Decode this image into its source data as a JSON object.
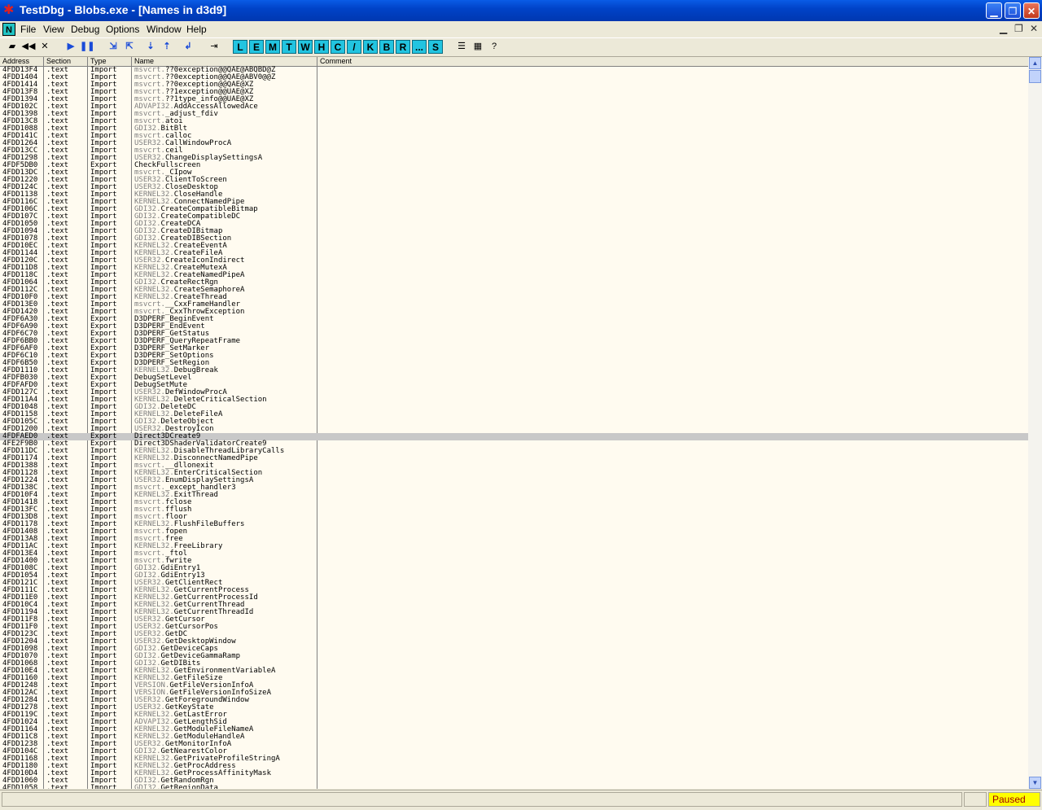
{
  "window": {
    "title": "TestDbg - Blobs.exe - [Names in d3d9]"
  },
  "menu": {
    "logo": "N",
    "items": [
      "File",
      "View",
      "Debug",
      "Options",
      "Window",
      "Help"
    ]
  },
  "toolbar": {
    "letter_buttons": [
      "L",
      "E",
      "M",
      "T",
      "W",
      "H",
      "C",
      "/",
      "K",
      "B",
      "R",
      "...",
      "S"
    ]
  },
  "table": {
    "columns": [
      "Address",
      "Section",
      "Type",
      "Name",
      "Comment"
    ],
    "selected_index": 50,
    "rows": [
      [
        "4FDD13F4",
        ".text",
        "Import",
        "msvcrt.",
        "??0exception@@QAE@ABQBD@Z"
      ],
      [
        "4FDD1404",
        ".text",
        "Import",
        "msvcrt.",
        "??0exception@@QAE@ABV0@@Z"
      ],
      [
        "4FDD1414",
        ".text",
        "Import",
        "msvcrt.",
        "??0exception@@QAE@XZ"
      ],
      [
        "4FDD13F8",
        ".text",
        "Import",
        "msvcrt.",
        "??1exception@@UAE@XZ"
      ],
      [
        "4FDD1394",
        ".text",
        "Import",
        "msvcrt.",
        "??1type_info@@UAE@XZ"
      ],
      [
        "4FDD102C",
        ".text",
        "Import",
        "ADVAPI32.",
        "AddAccessAllowedAce"
      ],
      [
        "4FDD1398",
        ".text",
        "Import",
        "msvcrt.",
        "_adjust_fdiv"
      ],
      [
        "4FDD13C8",
        ".text",
        "Import",
        "msvcrt.",
        "atoi"
      ],
      [
        "4FDD1088",
        ".text",
        "Import",
        "GDI32.",
        "BitBlt"
      ],
      [
        "4FDD141C",
        ".text",
        "Import",
        "msvcrt.",
        "calloc"
      ],
      [
        "4FDD1264",
        ".text",
        "Import",
        "USER32.",
        "CallWindowProcA"
      ],
      [
        "4FDD13CC",
        ".text",
        "Import",
        "msvcrt.",
        "ceil"
      ],
      [
        "4FDD1298",
        ".text",
        "Import",
        "USER32.",
        "ChangeDisplaySettingsA"
      ],
      [
        "4FDF5DB0",
        ".text",
        "Export",
        "",
        "CheckFullscreen"
      ],
      [
        "4FDD13DC",
        ".text",
        "Import",
        "msvcrt.",
        "_CIpow"
      ],
      [
        "4FDD1220",
        ".text",
        "Import",
        "USER32.",
        "ClientToScreen"
      ],
      [
        "4FDD124C",
        ".text",
        "Import",
        "USER32.",
        "CloseDesktop"
      ],
      [
        "4FDD1138",
        ".text",
        "Import",
        "KERNEL32.",
        "CloseHandle"
      ],
      [
        "4FDD116C",
        ".text",
        "Import",
        "KERNEL32.",
        "ConnectNamedPipe"
      ],
      [
        "4FDD106C",
        ".text",
        "Import",
        "GDI32.",
        "CreateCompatibleBitmap"
      ],
      [
        "4FDD107C",
        ".text",
        "Import",
        "GDI32.",
        "CreateCompatibleDC"
      ],
      [
        "4FDD1050",
        ".text",
        "Import",
        "GDI32.",
        "CreateDCA"
      ],
      [
        "4FDD1094",
        ".text",
        "Import",
        "GDI32.",
        "CreateDIBitmap"
      ],
      [
        "4FDD1078",
        ".text",
        "Import",
        "GDI32.",
        "CreateDIBSection"
      ],
      [
        "4FDD10EC",
        ".text",
        "Import",
        "KERNEL32.",
        "CreateEventA"
      ],
      [
        "4FDD1144",
        ".text",
        "Import",
        "KERNEL32.",
        "CreateFileA"
      ],
      [
        "4FDD120C",
        ".text",
        "Import",
        "USER32.",
        "CreateIconIndirect"
      ],
      [
        "4FDD11D8",
        ".text",
        "Import",
        "KERNEL32.",
        "CreateMutexA"
      ],
      [
        "4FDD118C",
        ".text",
        "Import",
        "KERNEL32.",
        "CreateNamedPipeA"
      ],
      [
        "4FDD1064",
        ".text",
        "Import",
        "GDI32.",
        "CreateRectRgn"
      ],
      [
        "4FDD112C",
        ".text",
        "Import",
        "KERNEL32.",
        "CreateSemaphoreA"
      ],
      [
        "4FDD10F0",
        ".text",
        "Import",
        "KERNEL32.",
        "CreateThread"
      ],
      [
        "4FDD13E0",
        ".text",
        "Import",
        "msvcrt.",
        "__CxxFrameHandler"
      ],
      [
        "4FDD1420",
        ".text",
        "Import",
        "msvcrt.",
        "_CxxThrowException"
      ],
      [
        "4FDF6A30",
        ".text",
        "Export",
        "",
        "D3DPERF_BeginEvent"
      ],
      [
        "4FDF6A90",
        ".text",
        "Export",
        "",
        "D3DPERF_EndEvent"
      ],
      [
        "4FDF6C70",
        ".text",
        "Export",
        "",
        "D3DPERF_GetStatus"
      ],
      [
        "4FDF6BB0",
        ".text",
        "Export",
        "",
        "D3DPERF_QueryRepeatFrame"
      ],
      [
        "4FDF6AF0",
        ".text",
        "Export",
        "",
        "D3DPERF_SetMarker"
      ],
      [
        "4FDF6C10",
        ".text",
        "Export",
        "",
        "D3DPERF_SetOptions"
      ],
      [
        "4FDF6B50",
        ".text",
        "Export",
        "",
        "D3DPERF_SetRegion"
      ],
      [
        "4FDD1110",
        ".text",
        "Import",
        "KERNEL32.",
        "DebugBreak"
      ],
      [
        "4FDFB030",
        ".text",
        "Export",
        "",
        "DebugSetLevel"
      ],
      [
        "4FDFAFD0",
        ".text",
        "Export",
        "",
        "DebugSetMute"
      ],
      [
        "4FDD127C",
        ".text",
        "Import",
        "USER32.",
        "DefWindowProcA"
      ],
      [
        "4FDD11A4",
        ".text",
        "Import",
        "KERNEL32.",
        "DeleteCriticalSection"
      ],
      [
        "4FDD1048",
        ".text",
        "Import",
        "GDI32.",
        "DeleteDC"
      ],
      [
        "4FDD1158",
        ".text",
        "Import",
        "KERNEL32.",
        "DeleteFileA"
      ],
      [
        "4FDD105C",
        ".text",
        "Import",
        "GDI32.",
        "DeleteObject"
      ],
      [
        "4FDD1200",
        ".text",
        "Import",
        "USER32.",
        "DestroyIcon"
      ],
      [
        "4FDFAED0",
        ".text",
        "Export",
        "",
        "Direct3DCreate9"
      ],
      [
        "4FE2F9B0",
        ".text",
        "Export",
        "",
        "Direct3DShaderValidatorCreate9"
      ],
      [
        "4FDD11DC",
        ".text",
        "Import",
        "KERNEL32.",
        "DisableThreadLibraryCalls"
      ],
      [
        "4FDD1174",
        ".text",
        "Import",
        "KERNEL32.",
        "DisconnectNamedPipe"
      ],
      [
        "4FDD1388",
        ".text",
        "Import",
        "msvcrt.",
        "__dllonexit"
      ],
      [
        "4FDD1128",
        ".text",
        "Import",
        "KERNEL32.",
        "EnterCriticalSection"
      ],
      [
        "4FDD1224",
        ".text",
        "Import",
        "USER32.",
        "EnumDisplaySettingsA"
      ],
      [
        "4FDD138C",
        ".text",
        "Import",
        "msvcrt.",
        "_except_handler3"
      ],
      [
        "4FDD10F4",
        ".text",
        "Import",
        "KERNEL32.",
        "ExitThread"
      ],
      [
        "4FDD1418",
        ".text",
        "Import",
        "msvcrt.",
        "fclose"
      ],
      [
        "4FDD13FC",
        ".text",
        "Import",
        "msvcrt.",
        "fflush"
      ],
      [
        "4FDD13D8",
        ".text",
        "Import",
        "msvcrt.",
        "floor"
      ],
      [
        "4FDD1178",
        ".text",
        "Import",
        "KERNEL32.",
        "FlushFileBuffers"
      ],
      [
        "4FDD1408",
        ".text",
        "Import",
        "msvcrt.",
        "fopen"
      ],
      [
        "4FDD13A8",
        ".text",
        "Import",
        "msvcrt.",
        "free"
      ],
      [
        "4FDD11AC",
        ".text",
        "Import",
        "KERNEL32.",
        "FreeLibrary"
      ],
      [
        "4FDD13E4",
        ".text",
        "Import",
        "msvcrt.",
        "_ftol"
      ],
      [
        "4FDD1400",
        ".text",
        "Import",
        "msvcrt.",
        "fwrite"
      ],
      [
        "4FDD108C",
        ".text",
        "Import",
        "GDI32.",
        "GdiEntry1"
      ],
      [
        "4FDD1054",
        ".text",
        "Import",
        "GDI32.",
        "GdiEntry13"
      ],
      [
        "4FDD121C",
        ".text",
        "Import",
        "USER32.",
        "GetClientRect"
      ],
      [
        "4FDD111C",
        ".text",
        "Import",
        "KERNEL32.",
        "GetCurrentProcess"
      ],
      [
        "4FDD11E0",
        ".text",
        "Import",
        "KERNEL32.",
        "GetCurrentProcessId"
      ],
      [
        "4FDD10C4",
        ".text",
        "Import",
        "KERNEL32.",
        "GetCurrentThread"
      ],
      [
        "4FDD1194",
        ".text",
        "Import",
        "KERNEL32.",
        "GetCurrentThreadId"
      ],
      [
        "4FDD11F8",
        ".text",
        "Import",
        "USER32.",
        "GetCursor"
      ],
      [
        "4FDD11F0",
        ".text",
        "Import",
        "USER32.",
        "GetCursorPos"
      ],
      [
        "4FDD123C",
        ".text",
        "Import",
        "USER32.",
        "GetDC"
      ],
      [
        "4FDD1204",
        ".text",
        "Import",
        "USER32.",
        "GetDesktopWindow"
      ],
      [
        "4FDD1098",
        ".text",
        "Import",
        "GDI32.",
        "GetDeviceCaps"
      ],
      [
        "4FDD1070",
        ".text",
        "Import",
        "GDI32.",
        "GetDeviceGammaRamp"
      ],
      [
        "4FDD1068",
        ".text",
        "Import",
        "GDI32.",
        "GetDIBits"
      ],
      [
        "4FDD10E4",
        ".text",
        "Import",
        "KERNEL32.",
        "GetEnvironmentVariableA"
      ],
      [
        "4FDD1160",
        ".text",
        "Import",
        "KERNEL32.",
        "GetFileSize"
      ],
      [
        "4FDD1248",
        ".text",
        "Import",
        "VERSION.",
        "GetFileVersionInfoA"
      ],
      [
        "4FDD12AC",
        ".text",
        "Import",
        "VERSION.",
        "GetFileVersionInfoSizeA"
      ],
      [
        "4FDD1284",
        ".text",
        "Import",
        "USER32.",
        "GetForegroundWindow"
      ],
      [
        "4FDD1278",
        ".text",
        "Import",
        "USER32.",
        "GetKeyState"
      ],
      [
        "4FDD119C",
        ".text",
        "Import",
        "KERNEL32.",
        "GetLastError"
      ],
      [
        "4FDD1024",
        ".text",
        "Import",
        "ADVAPI32.",
        "GetLengthSid"
      ],
      [
        "4FDD1164",
        ".text",
        "Import",
        "KERNEL32.",
        "GetModuleFileNameA"
      ],
      [
        "4FDD11C8",
        ".text",
        "Import",
        "KERNEL32.",
        "GetModuleHandleA"
      ],
      [
        "4FDD1238",
        ".text",
        "Import",
        "USER32.",
        "GetMonitorInfoA"
      ],
      [
        "4FDD104C",
        ".text",
        "Import",
        "GDI32.",
        "GetNearestColor"
      ],
      [
        "4FDD1168",
        ".text",
        "Import",
        "KERNEL32.",
        "GetPrivateProfileStringA"
      ],
      [
        "4FDD1180",
        ".text",
        "Import",
        "KERNEL32.",
        "GetProcAddress"
      ],
      [
        "4FDD10D4",
        ".text",
        "Import",
        "KERNEL32.",
        "GetProcessAffinityMask"
      ],
      [
        "4FDD1060",
        ".text",
        "Import",
        "GDI32.",
        "GetRandomRgn"
      ],
      [
        "4FDD1058",
        ".text",
        "Import",
        "GDI32.",
        "GetRegionData"
      ]
    ]
  },
  "status": {
    "state": "Paused"
  },
  "icons": {
    "app": "bug-icon",
    "open": "folder-open-icon",
    "restart": "rewind-icon",
    "close": "close-icon",
    "run": "run-icon",
    "pause": "pause-icon",
    "step-into": "step-into-icon",
    "step-over": "step-over-icon",
    "trace-into": "trace-into-icon",
    "trace-over": "trace-over-icon",
    "execute-till-return": "execute-till-return-icon",
    "go-to": "go-to-icon",
    "list": "list-icon",
    "grid": "grid-icon",
    "help": "help-icon"
  }
}
